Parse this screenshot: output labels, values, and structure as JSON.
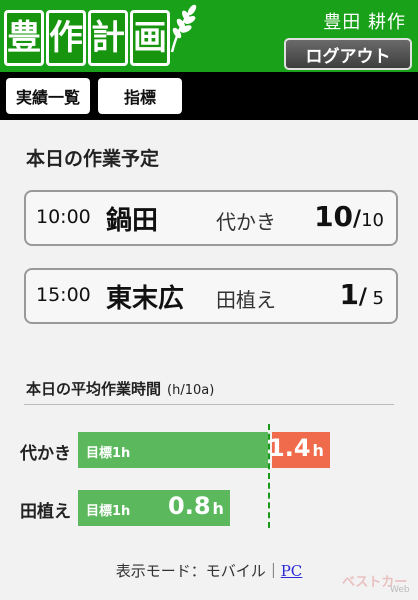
{
  "header": {
    "logo_chars": [
      "豊",
      "作",
      "計",
      "画"
    ],
    "user_name": "豊田 耕作",
    "logout_label": "ログアウト",
    "brand_color": "#1aa11a"
  },
  "nav": {
    "items": [
      {
        "label": "実績一覧"
      },
      {
        "label": "指標"
      }
    ]
  },
  "schedule": {
    "title": "本日の作業予定",
    "tasks": [
      {
        "time": "10:00",
        "field": "鍋田",
        "work": "代かき",
        "done": "10",
        "slash": "/",
        "total": "10"
      },
      {
        "time": "15:00",
        "field": "東末広",
        "work": "田植え",
        "done": "1",
        "slash": "/",
        "total": "5"
      }
    ]
  },
  "avg": {
    "title": "本日の平均作業時間",
    "unit": "(h/10a)",
    "rows": [
      {
        "label": "代かき",
        "target_label": "目標1h",
        "value": 1.4,
        "value_text": "1.4",
        "unit": "h",
        "target": 1.0
      },
      {
        "label": "田植え",
        "target_label": "目標1h",
        "value": 0.8,
        "value_text": "0.8",
        "unit": "h",
        "target": 1.0
      }
    ],
    "colors": {
      "under": "#5cb85c",
      "over": "#ef6b4b",
      "target_line": "#1a9a1a"
    }
  },
  "footer": {
    "mode_text": "表示モード：モバイル｜",
    "pc_link": "PC"
  },
  "watermark": {
    "text": "ベストカー",
    "sub": "Web"
  }
}
